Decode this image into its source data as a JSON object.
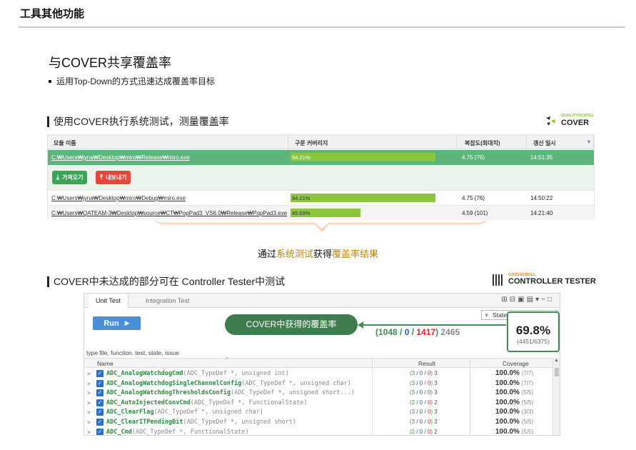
{
  "page": {
    "title": "工具其他功能"
  },
  "section": {
    "title": "与COVER共享覆盖率",
    "bullet": "运用Top-Down的方式迅速达成覆盖率目标"
  },
  "cover_part": {
    "heading": "使用COVER执行系统测试，测量覆盖率",
    "logo_small": "QUALITYSCROLL",
    "logo_big": "COVER",
    "table": {
      "headers": [
        "모듈 이름",
        "구문 커버리지",
        "복잡도(최대치)",
        "갱신 일시"
      ],
      "rows": [
        {
          "path": "C:₩Users₩jyna₩Desktop₩miro₩Release₩miro.exe",
          "coverage": "94.21%",
          "coverage_fraction": 0.9421,
          "complexity": "4.75 (76)",
          "time": "14:51:35",
          "selected": true
        },
        {
          "path": "C:₩Users₩jyna₩Desktop₩miro₩Debug₩miro.exe",
          "coverage": "94.21%",
          "coverage_fraction": 0.9421,
          "complexity": "4.75 (76)",
          "time": "14:50:22",
          "selected": false
        },
        {
          "path": "C:₩Users₩QATEAM-3₩Desktop₩source₩CT₩PopPad3_VS6.0₩Release₩PopPad3.exe",
          "coverage": "45.69%",
          "coverage_fraction": 0.4569,
          "complexity": "4.59 (101)",
          "time": "14:21:40",
          "selected": false
        }
      ],
      "import_button": "가져오기",
      "export_button": "내보내기"
    },
    "result": {
      "prefix": "通过",
      "hl1": "系统测试",
      "middle": "获得",
      "hl2": "覆盖率结果"
    }
  },
  "ct_part": {
    "heading": "COVER中未达成的部分可在 Controller Tester中测试",
    "logo_small": "CODESCROLL",
    "logo_big": "CONTROLLER TESTER",
    "tabs": [
      "Unit Test",
      "Integration Test"
    ],
    "run_label": "Run",
    "coverage_select": "Statement Coverage",
    "counts": {
      "open": "(",
      "passed": "1048",
      "sep1": " / ",
      "blocked": "0",
      "sep2": " / ",
      "failed": "1417",
      "close": ")",
      "total": "2465"
    },
    "coverage_pct": "69.8%",
    "coverage_frac": "(4451/6375)",
    "callout": "COVER中获得的覆盖率",
    "filter_placeholder": "type file, function, test, state, issue",
    "grid_headers": {
      "name": "Name",
      "result": "Result",
      "coverage": "Coverage"
    },
    "rows": [
      {
        "name": "ADC_AnalogWatchdogCmd",
        "args": "(ADC_TypeDef *, unsigned int)",
        "pass": "3",
        "block": "0",
        "fail": "0",
        "total": "3",
        "cov": "100.0%",
        "frac": "(7/7)"
      },
      {
        "name": "ADC_AnalogWatchdogSingleChannelConfig",
        "args": "(ADC_TypeDef *, unsigned char)",
        "pass": "3",
        "block": "0",
        "fail": "0",
        "total": "3",
        "cov": "100.0%",
        "frac": "(7/7)"
      },
      {
        "name": "ADC_AnalogWatchdogThresholdsConfig",
        "args": "(ADC_TypeDef *, unsigned short...)",
        "pass": "3",
        "block": "0",
        "fail": "0",
        "total": "3",
        "cov": "100.0%",
        "frac": "(5/5)"
      },
      {
        "name": "ADC_AutoInjectedConvCmd",
        "args": "(ADC_TypeDef *, FunctionalState)",
        "pass": "2",
        "block": "0",
        "fail": "0",
        "total": "2",
        "cov": "100.0%",
        "frac": "(5/5)"
      },
      {
        "name": "ADC_ClearFlag",
        "args": "(ADC_TypeDef *, unsigned char)",
        "pass": "3",
        "block": "0",
        "fail": "0",
        "total": "3",
        "cov": "100.0%",
        "frac": "(3/3)"
      },
      {
        "name": "ADC_ClearITPendingBit",
        "args": "(ADC_TypeDef *, unsigned short)",
        "pass": "3",
        "block": "0",
        "fail": "0",
        "total": "3",
        "cov": "100.0%",
        "frac": "(5/5)"
      },
      {
        "name": "ADC_Cmd",
        "args": "(ADC_TypeDef *, FunctionalState)",
        "pass": "2",
        "block": "0",
        "fail": "0",
        "total": "2",
        "cov": "100.0%",
        "frac": "(5/5)"
      }
    ]
  },
  "colors": {
    "accent_green": "#3f8f4f",
    "row_selected": "#5cb67c",
    "bar_green": "#8cc63f",
    "import_green": "#3aa655",
    "export_red": "#e8453c",
    "highlight_gold": "#b8860b",
    "run_blue": "#4a90d9"
  }
}
